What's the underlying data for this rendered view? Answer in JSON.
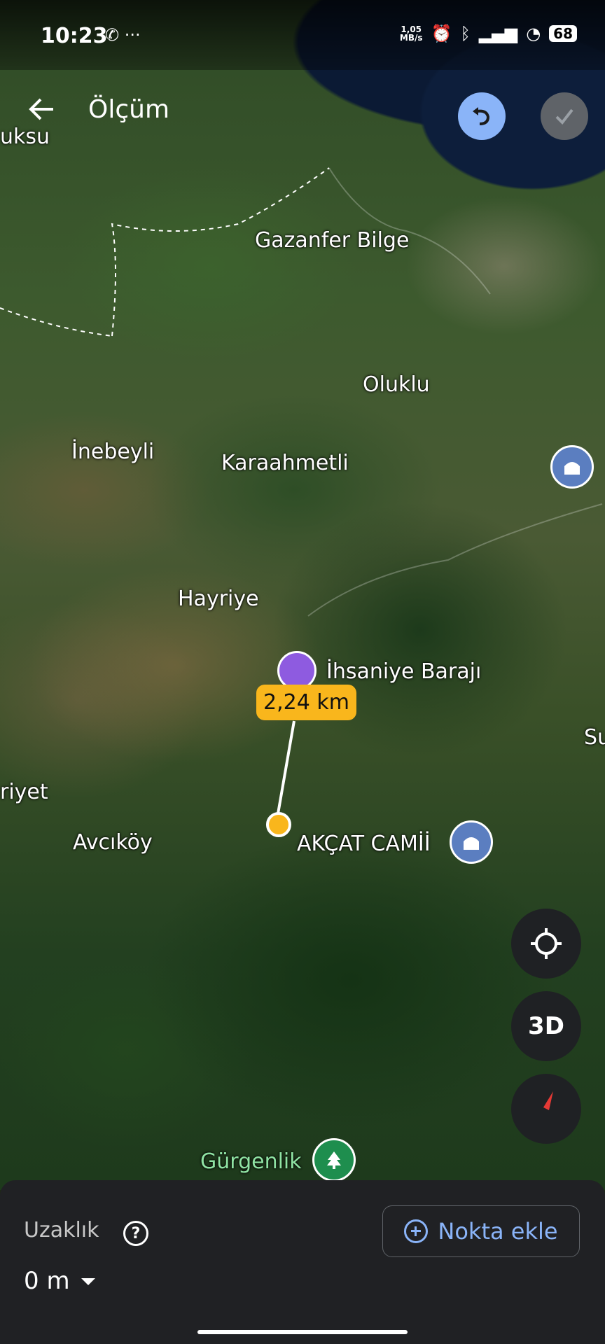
{
  "status": {
    "time": "10:23",
    "netspeed_value": "1,05",
    "netspeed_unit": "MB/s",
    "battery": "68"
  },
  "header": {
    "title": "Ölçüm"
  },
  "map": {
    "labels": [
      "uksu",
      "Gazanfer Bilge",
      "Oluklu",
      "İnebeyli",
      "Karaahmetli",
      "Hayriye",
      "İhsaniye Barajı",
      "riyet",
      "Avcıköy",
      "AKÇAT CAMİİ",
      "Gürgenlik",
      "Su"
    ],
    "measurement": "2,24 km"
  },
  "controls": {
    "three_d": "3D"
  },
  "sheet": {
    "label": "Uzaklık",
    "help": "?",
    "value": "0 m",
    "add_point": "Nokta ekle"
  },
  "colors": {
    "accent": "#8ab4f8",
    "measure": "#f9b61c"
  }
}
